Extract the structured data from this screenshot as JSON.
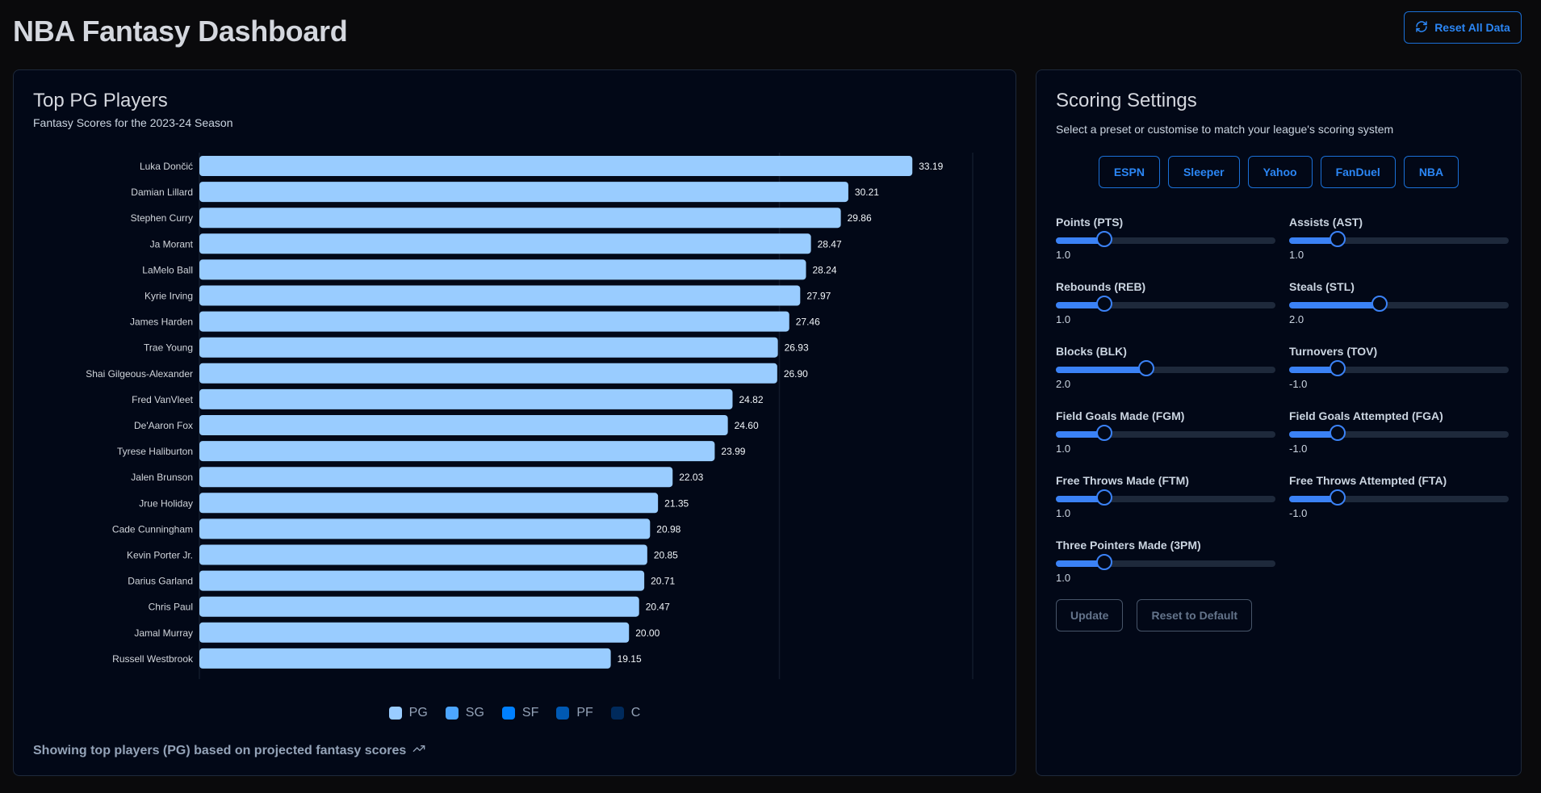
{
  "header": {
    "title": "NBA Fantasy Dashboard",
    "reset_all_label": "Reset All Data",
    "reset_icon": "refresh-icon"
  },
  "chart_card": {
    "title": "Top PG Players",
    "subtitle": "Fantasy Scores for the 2023-24 Season",
    "footer": "Showing top players (PG) based on projected fantasy scores",
    "footer_icon": "trending-up-icon"
  },
  "chart_data": {
    "type": "bar",
    "orientation": "horizontal",
    "title": "Top PG Players",
    "subtitle": "Fantasy Scores for the 2023-24 Season",
    "xlabel": "",
    "ylabel": "",
    "xlim": [
      0,
      36
    ],
    "gridlines_x_estimated": [
      0,
      27,
      36
    ],
    "grid": true,
    "series_color": "#99ccff",
    "categories": [
      "Luka Dončić",
      "Damian Lillard",
      "Stephen Curry",
      "Ja Morant",
      "LaMelo Ball",
      "Kyrie Irving",
      "James Harden",
      "Trae Young",
      "Shai Gilgeous-Alexander",
      "Fred VanVleet",
      "De'Aaron Fox",
      "Tyrese Haliburton",
      "Jalen Brunson",
      "Jrue Holiday",
      "Cade Cunningham",
      "Kevin Porter Jr.",
      "Darius Garland",
      "Chris Paul",
      "Jamal Murray",
      "Russell Westbrook"
    ],
    "values": [
      33.19,
      30.21,
      29.86,
      28.47,
      28.24,
      27.97,
      27.46,
      26.93,
      26.9,
      24.82,
      24.6,
      23.99,
      22.03,
      21.35,
      20.98,
      20.85,
      20.71,
      20.47,
      20.0,
      19.15
    ],
    "value_labels": [
      "33.19",
      "30.21",
      "29.86",
      "28.47",
      "28.24",
      "27.97",
      "27.46",
      "26.93",
      "26.90",
      "24.82",
      "24.60",
      "23.99",
      "22.03",
      "21.35",
      "20.98",
      "20.85",
      "20.71",
      "20.47",
      "20.00",
      "19.15"
    ],
    "legend_position": "bottom-center",
    "legend": [
      {
        "label": "PG",
        "color": "#99ccff"
      },
      {
        "label": "SG",
        "color": "#4da6ff"
      },
      {
        "label": "SF",
        "color": "#0080ff"
      },
      {
        "label": "PF",
        "color": "#0059b3"
      },
      {
        "label": "C",
        "color": "#002a5c"
      }
    ]
  },
  "settings": {
    "title": "Scoring Settings",
    "subtitle": "Select a preset or customise to match your league's scoring system",
    "presets": [
      "ESPN",
      "Sleeper",
      "Yahoo",
      "FanDuel",
      "NBA"
    ],
    "sliders": [
      {
        "label": "Points (PTS)",
        "value": "1.0",
        "fill_fraction": 0.22
      },
      {
        "label": "Assists (AST)",
        "value": "1.0",
        "fill_fraction": 0.22
      },
      {
        "label": "Rebounds (REB)",
        "value": "1.0",
        "fill_fraction": 0.22
      },
      {
        "label": "Steals (STL)",
        "value": "2.0",
        "fill_fraction": 0.41
      },
      {
        "label": "Blocks (BLK)",
        "value": "2.0",
        "fill_fraction": 0.41
      },
      {
        "label": "Turnovers (TOV)",
        "value": "-1.0",
        "fill_fraction": 0.22
      },
      {
        "label": "Field Goals Made (FGM)",
        "value": "1.0",
        "fill_fraction": 0.22
      },
      {
        "label": "Field Goals Attempted (FGA)",
        "value": "-1.0",
        "fill_fraction": 0.22
      },
      {
        "label": "Free Throws Made (FTM)",
        "value": "1.0",
        "fill_fraction": 0.22
      },
      {
        "label": "Free Throws Attempted (FTA)",
        "value": "-1.0",
        "fill_fraction": 0.22
      },
      {
        "label": "Three Pointers Made (3PM)",
        "value": "1.0",
        "fill_fraction": 0.22
      }
    ],
    "update_label": "Update",
    "reset_default_label": "Reset to Default"
  },
  "colors": {
    "accent": "#3b82f6",
    "button_blue": "#2b86f5",
    "card_bg": "#020817",
    "page_bg": "#0a0a0c"
  }
}
